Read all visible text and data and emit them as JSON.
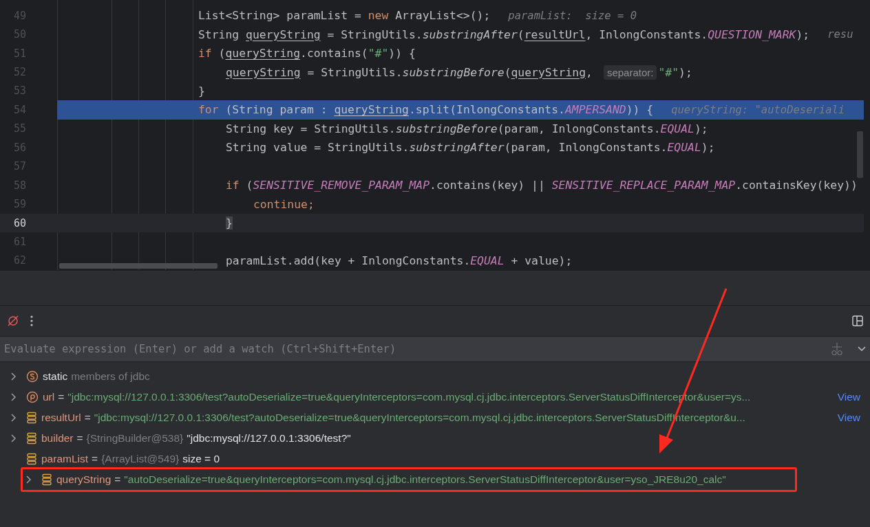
{
  "editor": {
    "lines": [
      {
        "number": "49",
        "execution_point": false,
        "caret": false,
        "tokens": [
          {
            "text": "List<String> paramList = ",
            "kind": "plain"
          },
          {
            "text": "new",
            "kind": "kw"
          },
          {
            "text": " ArrayList<>();",
            "kind": "plain"
          },
          {
            "text": "paramList:  size = 0",
            "kind": "hint"
          }
        ]
      },
      {
        "number": "50",
        "execution_point": false,
        "caret": false,
        "tokens": [
          {
            "text": "String ",
            "kind": "plain"
          },
          {
            "text": "queryString",
            "kind": "var"
          },
          {
            "text": " = StringUtils.",
            "kind": "plain"
          },
          {
            "text": "substringAfter",
            "kind": "method"
          },
          {
            "text": "(",
            "kind": "plain"
          },
          {
            "text": "resultUrl",
            "kind": "var"
          },
          {
            "text": ", InlongConstants.",
            "kind": "plain"
          },
          {
            "text": "QUESTION_MARK",
            "kind": "const"
          },
          {
            "text": ");",
            "kind": "plain"
          },
          {
            "text": "resu",
            "kind": "hint"
          }
        ]
      },
      {
        "number": "51",
        "execution_point": false,
        "caret": false,
        "tokens": [
          {
            "text": "if",
            "kind": "kw"
          },
          {
            "text": " (",
            "kind": "plain"
          },
          {
            "text": "queryString",
            "kind": "var"
          },
          {
            "text": ".contains(",
            "kind": "plain"
          },
          {
            "text": "\"#\"",
            "kind": "str"
          },
          {
            "text": ")) {",
            "kind": "plain"
          }
        ],
        "children": [
          {
            "number": "52",
            "execution_point": false,
            "caret": false,
            "tokens": [
              {
                "text": "queryString",
                "kind": "var"
              },
              {
                "text": " = StringUtils.",
                "kind": "plain"
              },
              {
                "text": "substringBefore",
                "kind": "method"
              },
              {
                "text": "(",
                "kind": "plain"
              },
              {
                "text": "queryString",
                "kind": "var"
              },
              {
                "text": ",",
                "kind": "plain"
              },
              {
                "text": "separator:",
                "kind": "chip"
              },
              {
                "text": "\"#\"",
                "kind": "str"
              },
              {
                "text": ");",
                "kind": "plain"
              }
            ]
          }
        ]
      },
      {
        "number": "53",
        "execution_point": false,
        "caret": false,
        "tokens": [
          {
            "text": "}",
            "kind": "plain"
          }
        ]
      },
      {
        "number": "54",
        "execution_point": true,
        "caret": false,
        "tokens": [
          {
            "text": "for",
            "kind": "kw"
          },
          {
            "text": " (String param : ",
            "kind": "plain"
          },
          {
            "text": "queryString",
            "kind": "var"
          },
          {
            "text": ".split(InlongConstants.",
            "kind": "plain"
          },
          {
            "text": "AMPERSAND",
            "kind": "const"
          },
          {
            "text": ")) {",
            "kind": "plain"
          },
          {
            "text": "queryString: \"autoDeseriali",
            "kind": "hint"
          }
        ],
        "children": [
          {
            "number": "55",
            "execution_point": false,
            "caret": false,
            "tokens": [
              {
                "text": "String key = StringUtils.",
                "kind": "plain"
              },
              {
                "text": "substringBefore",
                "kind": "method"
              },
              {
                "text": "(param, InlongConstants.",
                "kind": "plain"
              },
              {
                "text": "EQUAL",
                "kind": "const"
              },
              {
                "text": ");",
                "kind": "plain"
              }
            ]
          },
          {
            "number": "56",
            "execution_point": false,
            "caret": false,
            "tokens": [
              {
                "text": "String value = StringUtils.",
                "kind": "plain"
              },
              {
                "text": "substringAfter",
                "kind": "method"
              },
              {
                "text": "(param, InlongConstants.",
                "kind": "plain"
              },
              {
                "text": "EQUAL",
                "kind": "const"
              },
              {
                "text": ");",
                "kind": "plain"
              }
            ]
          },
          {
            "number": "57",
            "execution_point": false,
            "caret": false
          },
          {
            "number": "58",
            "execution_point": false,
            "caret": false,
            "tokens": [
              {
                "text": "if",
                "kind": "kw"
              },
              {
                "text": " (",
                "kind": "plain"
              },
              {
                "text": "SENSITIVE_REMOVE_PARAM_MAP",
                "kind": "const"
              },
              {
                "text": ".contains(key) || ",
                "kind": "plain"
              },
              {
                "text": "SENSITIVE_REPLACE_PARAM_MAP",
                "kind": "const"
              },
              {
                "text": ".containsKey(key))",
                "kind": "plain"
              }
            ],
            "children": [
              {
                "number": "59",
                "execution_point": false,
                "caret": false,
                "tokens": [
                  {
                    "text": "continue;",
                    "kind": "kw"
                  }
                ]
              }
            ]
          },
          {
            "number": "60",
            "execution_point": false,
            "caret": true,
            "tokens": [
              {
                "text": "}",
                "kind": "brace"
              }
            ]
          },
          {
            "number": "61",
            "execution_point": false,
            "caret": false
          },
          {
            "number": "62",
            "execution_point": false,
            "caret": false,
            "tokens": [
              {
                "text": "paramList.add(key + InlongConstants.",
                "kind": "plain"
              },
              {
                "text": "EQUAL",
                "kind": "const"
              },
              {
                "text": " + value);",
                "kind": "plain"
              }
            ]
          }
        ]
      }
    ]
  },
  "debugger": {
    "evaluate": {
      "placeholder": "Evaluate expression (Enter) or add a watch (Ctrl+Shift+Enter)"
    },
    "variables": [
      {
        "kind": "static",
        "expandable": true,
        "boxed": false,
        "name": "static",
        "type": "members of jdbc"
      },
      {
        "kind": "param",
        "expandable": true,
        "boxed": false,
        "name": "url",
        "operator": "=",
        "value": "\"jdbc:mysql://127.0.0.1:3306/test?autoDeserialize=true&queryInterceptors=com.mysql.cj.jdbc.interceptors.ServerStatusDiffInterceptor&user=ys...",
        "link": "View"
      },
      {
        "kind": "field",
        "expandable": true,
        "boxed": false,
        "name": "resultUrl",
        "operator": "=",
        "value": "\"jdbc:mysql://127.0.0.1:3306/test?autoDeserialize=true&queryInterceptors=com.mysql.cj.jdbc.interceptors.ServerStatusDiffInterceptor&u...",
        "link": "View"
      },
      {
        "kind": "field",
        "expandable": true,
        "boxed": false,
        "name": "builder",
        "operator": "=",
        "type": "{StringBuilder@538}",
        "value": "\"jdbc:mysql://127.0.0.1:3306/test?\"",
        "plain": true
      },
      {
        "kind": "field",
        "expandable": false,
        "boxed": false,
        "name": "paramList",
        "operator": "=",
        "type": "{ArrayList@549}",
        "value": " size = 0",
        "plain": true
      },
      {
        "kind": "field",
        "expandable": true,
        "boxed": true,
        "name": "queryString",
        "operator": "=",
        "value": "\"autoDeserialize=true&queryInterceptors=com.mysql.cj.jdbc.interceptors.ServerStatusDiffInterceptor&user=yso_JRE8u20_calc\"",
        "plain": false
      }
    ]
  }
}
